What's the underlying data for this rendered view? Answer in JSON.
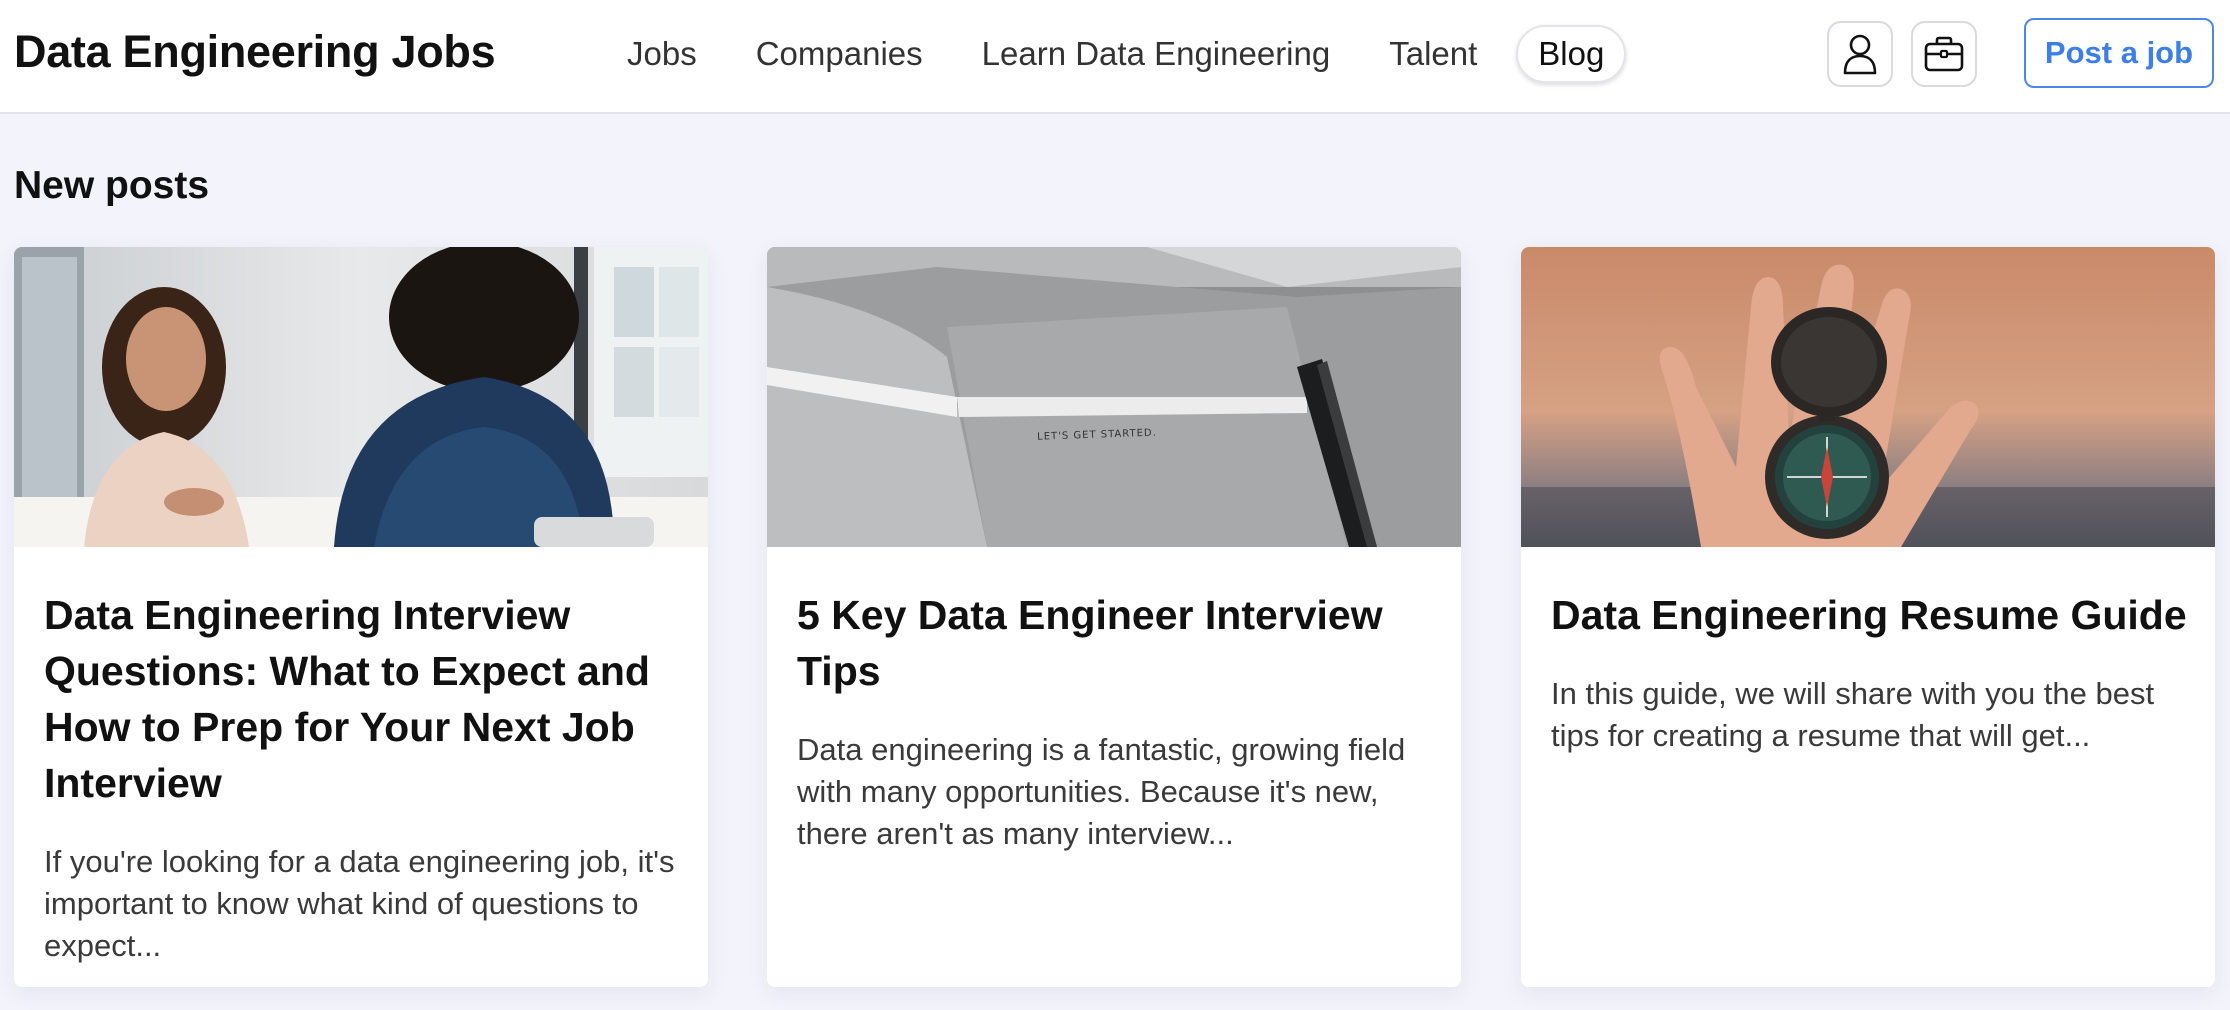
{
  "header": {
    "brand": "Data Engineering Jobs",
    "nav": [
      {
        "label": "Jobs"
      },
      {
        "label": "Companies"
      },
      {
        "label": "Learn Data Engineering"
      },
      {
        "label": "Talent"
      },
      {
        "label": "Blog",
        "active": true
      }
    ],
    "user_icon": "user-icon",
    "briefcase_icon": "briefcase-icon",
    "post_button": "Post a job"
  },
  "section": {
    "title": "New posts"
  },
  "posts": [
    {
      "title": "Data Engineering Interview Questions: What to Expect and How to Prep for Your Next Job Interview",
      "excerpt": "If you're looking for a data engineering job, it's important to know what kind of questions to expect...",
      "image": "interview-photo"
    },
    {
      "title": "5 Key Data Engineer Interview Tips",
      "excerpt": "Data engineering is a fantastic, growing field with many opportunities. Because it's new, there aren't as many interview...",
      "image": "notebook-photo",
      "image_caption": "LET'S GET STARTED."
    },
    {
      "title": "Data Engineering Resume Guide",
      "excerpt": "In this guide, we will share with you the best tips for creating a resume that will get...",
      "image": "compass-photo"
    }
  ],
  "colors": {
    "accent": "#3d7fe6",
    "page_bg": "#f3f3fb",
    "card_bg": "#ffffff"
  }
}
